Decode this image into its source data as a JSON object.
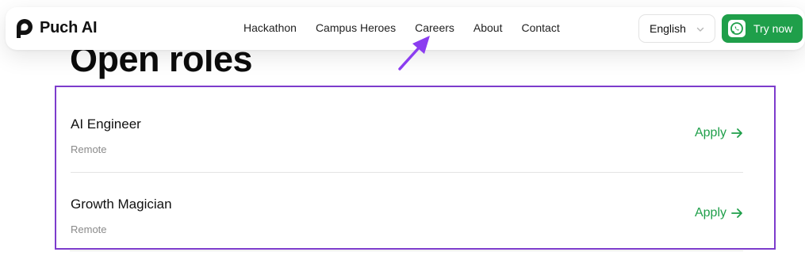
{
  "brand": {
    "name": "Puch AI",
    "logo_icon": "puch-logo-icon"
  },
  "nav": {
    "links": [
      {
        "label": "Hackathon"
      },
      {
        "label": "Campus Heroes"
      },
      {
        "label": "Careers"
      },
      {
        "label": "About"
      },
      {
        "label": "Contact"
      }
    ]
  },
  "language": {
    "selected": "English"
  },
  "cta": {
    "label": "Try now",
    "icon": "whatsapp-icon",
    "color": "#1f9f4a"
  },
  "page": {
    "title": "Open roles"
  },
  "roles": [
    {
      "title": "AI Engineer",
      "location": "Remote",
      "action": "Apply"
    },
    {
      "title": "Growth Magician",
      "location": "Remote",
      "action": "Apply"
    }
  ],
  "colors": {
    "accent_green": "#1f9f4a",
    "highlight_purple": "#7d3ccc",
    "annotation_arrow": "#8b3df0"
  }
}
